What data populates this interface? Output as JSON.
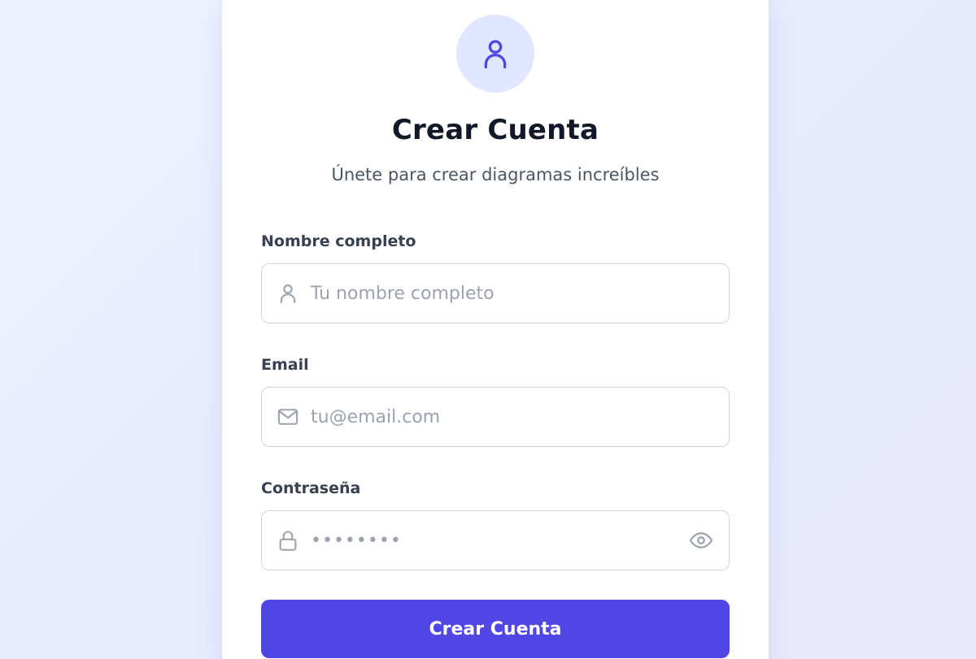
{
  "header": {
    "icon": "user-icon",
    "title": "Crear Cuenta",
    "subtitle": "Únete para crear diagramas increíbles"
  },
  "form": {
    "name": {
      "label": "Nombre completo",
      "placeholder": "Tu nombre completo",
      "value": "",
      "icon": "user-icon"
    },
    "email": {
      "label": "Email",
      "placeholder": "tu@email.com",
      "value": "",
      "icon": "mail-icon"
    },
    "password": {
      "label": "Contraseña",
      "placeholder": "••••••••",
      "value": "",
      "icon": "lock-icon",
      "toggle_icon": "eye-icon"
    },
    "submit_label": "Crear Cuenta"
  },
  "colors": {
    "accent": "#4f46e5",
    "avatar_bg": "#e0e7ff",
    "page_bg": "#eef2ff"
  }
}
